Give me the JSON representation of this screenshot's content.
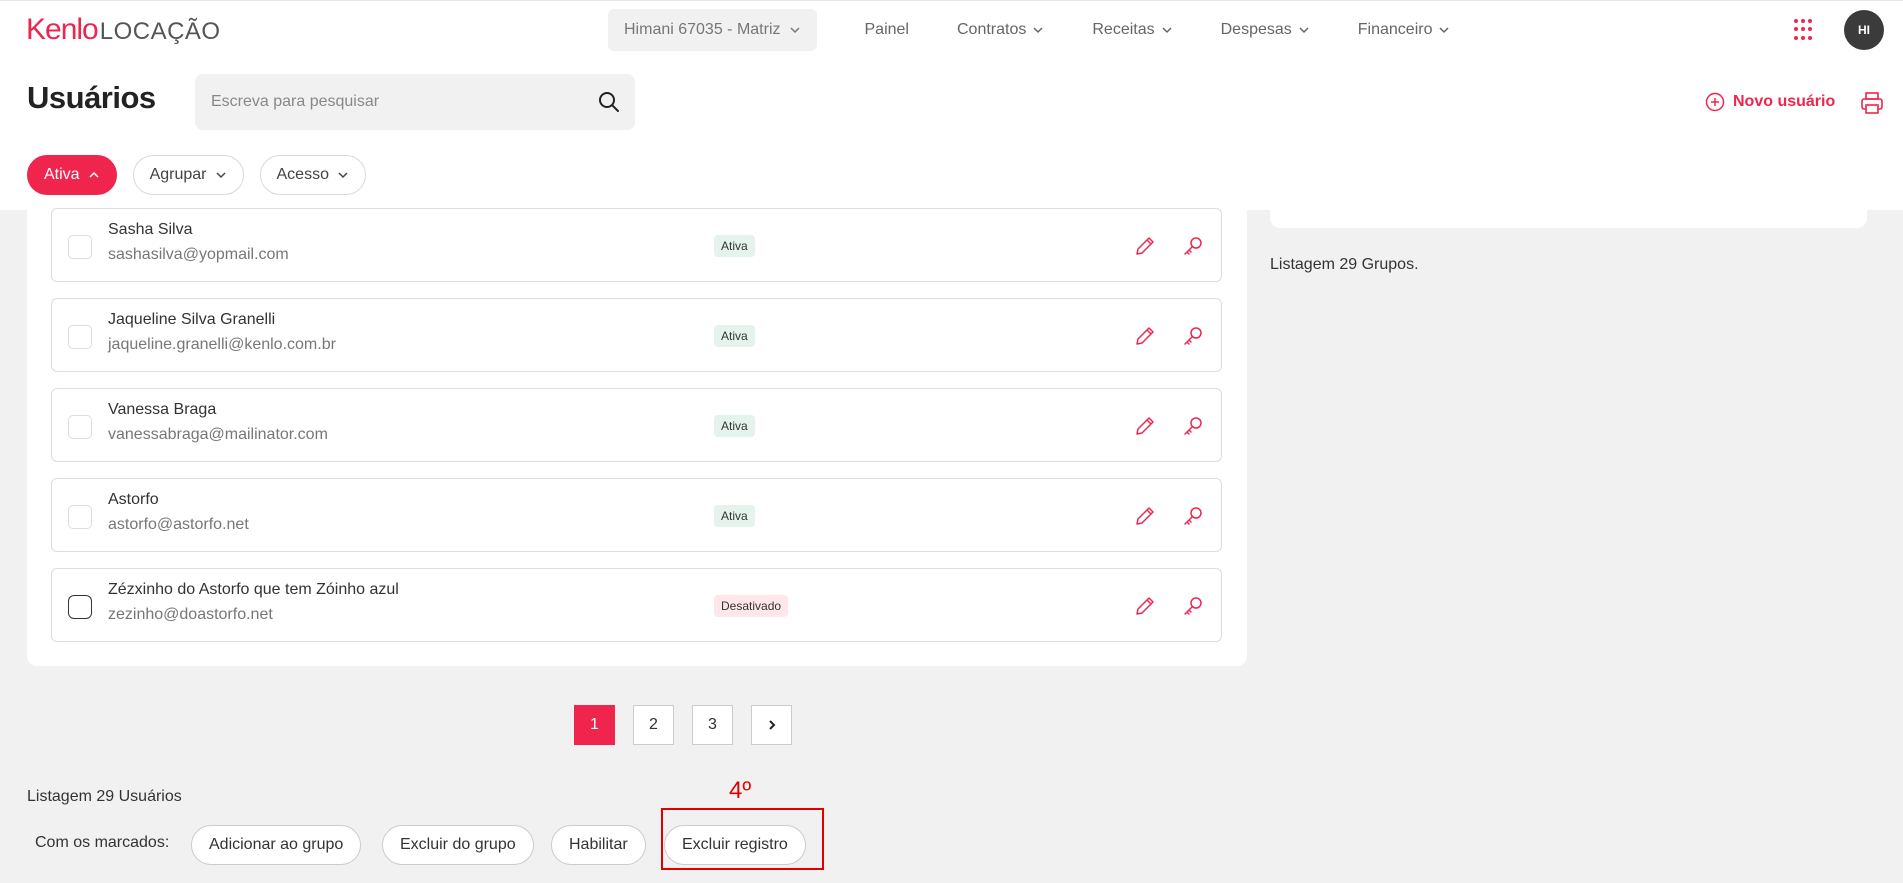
{
  "brand": {
    "name": "Kenlo",
    "product": "LOCAÇÃO",
    "accent_color": "#f0254e"
  },
  "nav": {
    "company": "Himani 67035 - Matriz",
    "items": [
      {
        "label": "Painel",
        "has_dropdown": false
      },
      {
        "label": "Contratos",
        "has_dropdown": true
      },
      {
        "label": "Receitas",
        "has_dropdown": true
      },
      {
        "label": "Despesas",
        "has_dropdown": true
      },
      {
        "label": "Financeiro",
        "has_dropdown": true
      }
    ],
    "apps_icon": "grid-dots-icon",
    "avatar_initials": "HI"
  },
  "header": {
    "title": "Usuários",
    "search_placeholder": "Escreva para pesquisar",
    "new_user_label": "Novo usuário",
    "print_icon": "printer-icon"
  },
  "filters": [
    {
      "label": "Ativa",
      "active": true
    },
    {
      "label": "Agrupar",
      "active": false
    },
    {
      "label": "Acesso",
      "active": false
    }
  ],
  "users": [
    {
      "name": "Sasha Silva",
      "email": "sashasilva@yopmail.com",
      "status": "Ativa"
    },
    {
      "name": "Jaqueline Silva Granelli",
      "email": "jaqueline.granelli@kenlo.com.br",
      "status": "Ativa"
    },
    {
      "name": "Vanessa Braga",
      "email": "vanessabraga@mailinator.com",
      "status": "Ativa"
    },
    {
      "name": "Astorfo",
      "email": "astorfo@astorfo.net",
      "status": "Ativa"
    },
    {
      "name": "Zézxinho do Astorfo que tem Zóinho azul",
      "email": "zezinho@doastorfo.net",
      "status": "Desativado"
    }
  ],
  "groups": {
    "count_label": "Listagem 29 Grupos."
  },
  "pagination": {
    "pages": [
      "1",
      "2",
      "3"
    ],
    "current": "1",
    "next_label": "›"
  },
  "footer": {
    "users_count_label": "Listagem 29 Usuários",
    "bulk_label": "Com os marcados:",
    "actions": [
      "Adicionar ao grupo",
      "Excluir do grupo",
      "Habilitar",
      "Excluir registro"
    ]
  },
  "annotation": {
    "label": "4º",
    "color": "#e00000"
  }
}
